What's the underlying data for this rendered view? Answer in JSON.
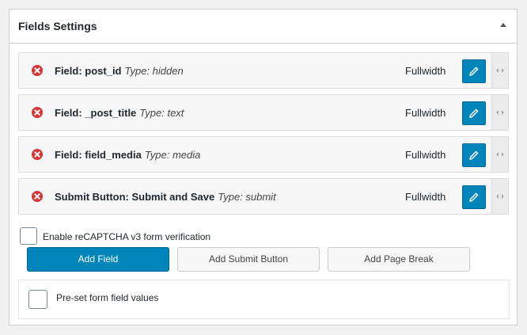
{
  "panel": {
    "title": "Fields Settings"
  },
  "fields": [
    {
      "name": "Field: post_id",
      "type": "Type: hidden",
      "width": "Fullwidth"
    },
    {
      "name": "Field: _post_title",
      "type": "Type: text",
      "width": "Fullwidth"
    },
    {
      "name": "Field: field_media",
      "type": "Type: media",
      "width": "Fullwidth"
    },
    {
      "name": "Submit Button: Submit and Save",
      "type": "Type: submit",
      "width": "Fullwidth"
    }
  ],
  "recaptcha": {
    "label": "Enable reCAPTCHA v3 form verification",
    "checked": false
  },
  "buttons": {
    "add_field": "Add Field",
    "add_submit": "Add Submit Button",
    "add_page_break": "Add Page Break"
  },
  "preset": {
    "label": "Pre-set form field values",
    "checked": false
  },
  "colors": {
    "accent": "#0085ba",
    "remove": "#d63638"
  },
  "icons": {
    "remove": "remove-circle-icon",
    "edit": "pencil-icon",
    "drag": "drag-handle-icon",
    "collapse": "triangle-up-icon"
  }
}
